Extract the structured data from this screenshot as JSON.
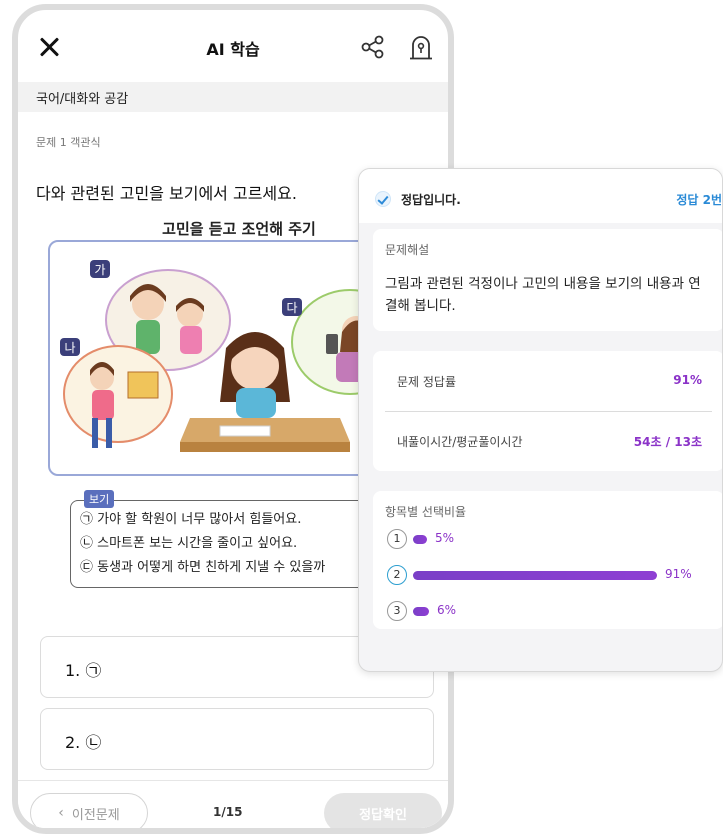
{
  "header": {
    "title": "AI 학습",
    "close_icon": "close-icon",
    "share_icon": "share-icon",
    "report_icon": "report-icon"
  },
  "subject": "국어/대화와 공감",
  "question": {
    "meta": "문제 1 객관식",
    "text": "다와 관련된 고민을 보기에서 고르세요.",
    "figure_title": "고민을 듣고 조언해 주기",
    "figure_labels": [
      "가",
      "나",
      "다"
    ],
    "view_tag": "보기",
    "view_items": [
      "㉠ 가야 할 학원이 너무 많아서 힘들어요.",
      "㉡ 스마트폰 보는 시간을 줄이고 싶어요.",
      "㉢ 동생과 어떻게 하면 친하게 지낼 수 있을까"
    ]
  },
  "options": [
    {
      "label": "1. ㉠"
    },
    {
      "label": "2. ㉡"
    }
  ],
  "footer": {
    "prev_label": "이전문제",
    "page": "1/15",
    "check_label": "정답확인"
  },
  "result": {
    "correct_text": "정답입니다.",
    "answer_badge": "정답 2번",
    "explanation_label": "문제해설",
    "explanation": "그림과 관련된 걱정이나 고민의 내용을 보기의 내용과 연결해 봅니다.",
    "accuracy_label": "문제 정답률",
    "accuracy_value": "91%",
    "time_label": "내풀이시간/평균풀이시간",
    "time_value": "54초 / 13초",
    "ratio_label": "항목별 선택비율",
    "choices": [
      {
        "num": "1",
        "pct": "5%",
        "fraction": 0.05,
        "selected": false
      },
      {
        "num": "2",
        "pct": "91%",
        "fraction": 0.91,
        "selected": true
      },
      {
        "num": "3",
        "pct": "6%",
        "fraction": 0.06,
        "selected": false
      }
    ],
    "accent_color": "#8b33c8",
    "correct_color": "#2a8ad6"
  }
}
